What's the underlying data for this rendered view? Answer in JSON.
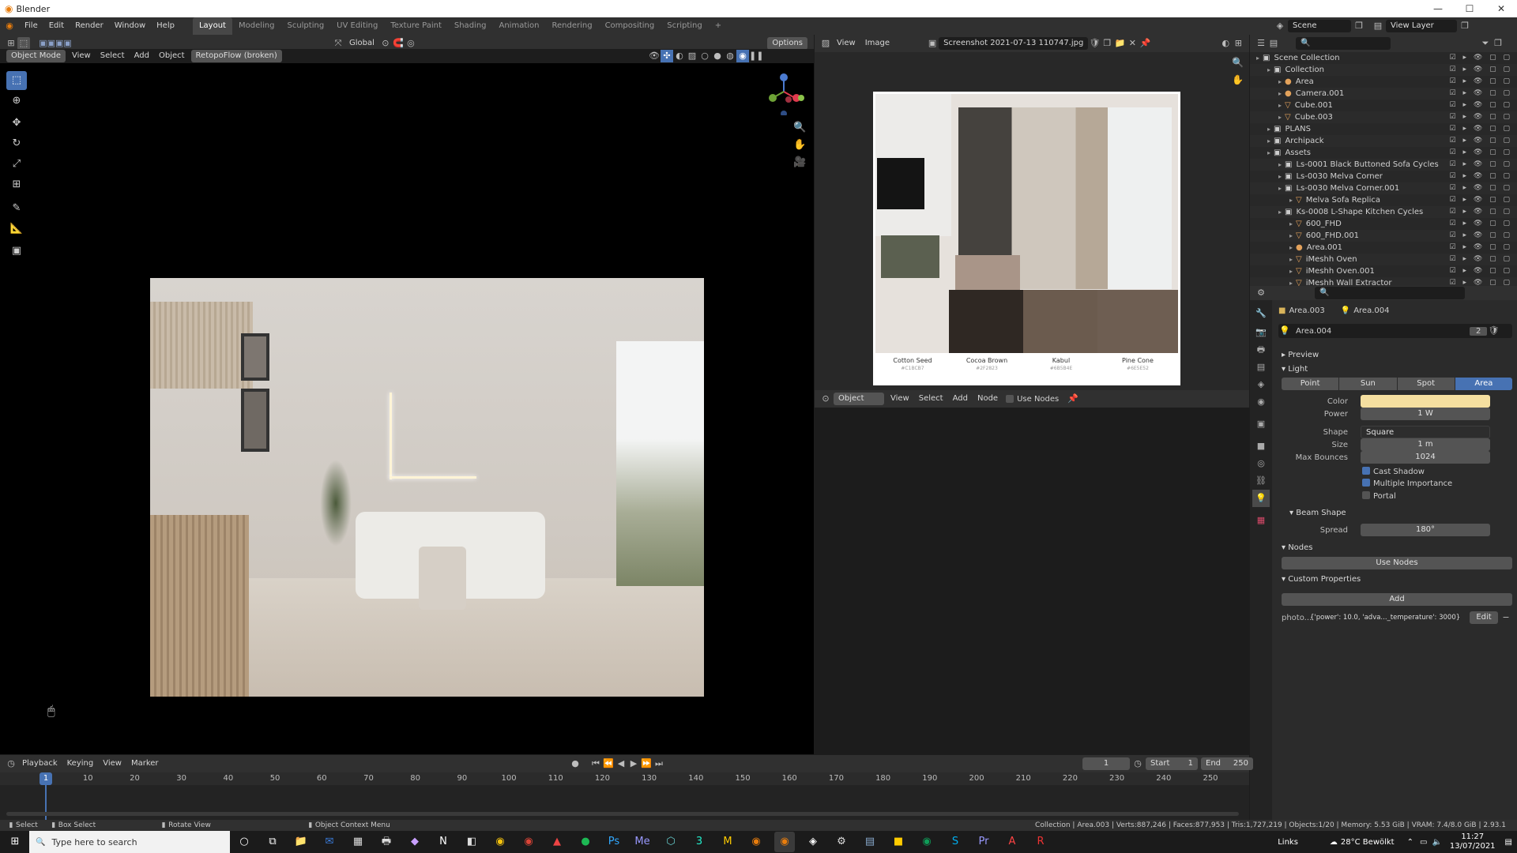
{
  "app": {
    "title": "Blender",
    "title_controls": [
      "—",
      "☐",
      "✕"
    ]
  },
  "menu": [
    "File",
    "Edit",
    "Render",
    "Window",
    "Help"
  ],
  "workspaces": [
    {
      "label": "Layout",
      "active": true
    },
    {
      "label": "Modeling"
    },
    {
      "label": "Sculpting"
    },
    {
      "label": "UV Editing"
    },
    {
      "label": "Texture Paint"
    },
    {
      "label": "Shading"
    },
    {
      "label": "Animation"
    },
    {
      "label": "Rendering"
    },
    {
      "label": "Compositing"
    },
    {
      "label": "Scripting"
    }
  ],
  "scene": {
    "name": "Scene",
    "view_layer": "View Layer"
  },
  "viewport": {
    "transform": "Global",
    "options": "Options",
    "mode": "Object Mode",
    "menus": [
      "View",
      "Select",
      "Add",
      "Object"
    ],
    "addon": "RetopoFlow (broken)"
  },
  "image_editor": {
    "menus": [
      "View",
      "Image"
    ],
    "filename": "Screenshot 2021-07-13 110747.jpg",
    "swatches": [
      {
        "name": "Cotton Seed",
        "code": "#C1BCB7"
      },
      {
        "name": "Cocoa Brown",
        "code": "#2F2823"
      },
      {
        "name": "Kabul",
        "code": "#6B5B4E"
      },
      {
        "name": "Pine Cone",
        "code": "#6E5E52"
      }
    ]
  },
  "node_editor": {
    "type": "Object",
    "menus": [
      "View",
      "Select",
      "Add",
      "Node"
    ],
    "use_nodes": "Use Nodes"
  },
  "outliner": {
    "items": [
      {
        "label": "Scene Collection",
        "indent": 0,
        "icon": "▣"
      },
      {
        "label": "Collection",
        "indent": 1,
        "icon": "▣"
      },
      {
        "label": "Area",
        "indent": 2,
        "icon": "●"
      },
      {
        "label": "Camera.001",
        "indent": 2,
        "icon": "●"
      },
      {
        "label": "Cube.001",
        "indent": 2,
        "icon": "▽"
      },
      {
        "label": "Cube.003",
        "indent": 2,
        "icon": "▽"
      },
      {
        "label": "PLANS",
        "indent": 1,
        "icon": "▣"
      },
      {
        "label": "Archipack",
        "indent": 1,
        "icon": "▣"
      },
      {
        "label": "Assets",
        "indent": 1,
        "icon": "▣"
      },
      {
        "label": "Ls-0001 Black Buttoned Sofa Cycles",
        "indent": 2,
        "icon": "▣"
      },
      {
        "label": "Ls-0030 Melva Corner",
        "indent": 2,
        "icon": "▣"
      },
      {
        "label": "Ls-0030 Melva Corner.001",
        "indent": 2,
        "icon": "▣"
      },
      {
        "label": "Melva Sofa Replica",
        "indent": 3,
        "icon": "▽"
      },
      {
        "label": "Ks-0008 L-Shape Kitchen Cycles",
        "indent": 2,
        "icon": "▣"
      },
      {
        "label": "600_FHD",
        "indent": 3,
        "icon": "▽"
      },
      {
        "label": "600_FHD.001",
        "indent": 3,
        "icon": "▽"
      },
      {
        "label": "Area.001",
        "indent": 3,
        "icon": "●"
      },
      {
        "label": "iMeshh Oven",
        "indent": 3,
        "icon": "▽"
      },
      {
        "label": "iMeshh Oven.001",
        "indent": 3,
        "icon": "▽"
      },
      {
        "label": "iMeshh Wall Extractor",
        "indent": 3,
        "icon": "▽"
      }
    ]
  },
  "properties": {
    "breadcrumb": [
      "Area.003",
      "Area.004"
    ],
    "datablock": "Area.004",
    "users": "2",
    "sections": {
      "preview": "Preview",
      "light": "Light",
      "beam": "Beam Shape",
      "nodes": "Nodes",
      "custom": "Custom Properties"
    },
    "light_types": [
      {
        "label": "Point"
      },
      {
        "label": "Sun"
      },
      {
        "label": "Spot"
      },
      {
        "label": "Area",
        "active": true
      }
    ],
    "color_label": "Color",
    "color": "#f5dfa0",
    "power_label": "Power",
    "power": "1 W",
    "shape_label": "Shape",
    "shape": "Square",
    "size_label": "Size",
    "size": "1 m",
    "bounces_label": "Max Bounces",
    "bounces": "1024",
    "cast_shadow": "Cast Shadow",
    "multiple_importance": "Multiple Importance",
    "portal": "Portal",
    "spread_label": "Spread",
    "spread": "180°",
    "use_nodes": "Use Nodes",
    "add": "Add",
    "custom_key": "photo...",
    "custom_value": "{'power': 10.0, 'adva..._temperature': 3000}",
    "edit": "Edit"
  },
  "timeline": {
    "menus": [
      "Playback",
      "Keying",
      "View",
      "Marker"
    ],
    "current": "1",
    "start_label": "Start",
    "start": "1",
    "end_label": "End",
    "end": "250",
    "ticks": [
      "1",
      "10",
      "20",
      "30",
      "40",
      "50",
      "60",
      "70",
      "80",
      "90",
      "100",
      "110",
      "120",
      "130",
      "140",
      "150",
      "160",
      "170",
      "180",
      "190",
      "200",
      "210",
      "220",
      "230",
      "240",
      "250"
    ]
  },
  "status": {
    "select": "Select",
    "box": "Box Select",
    "rotate": "Rotate View",
    "context": "Object Context Menu",
    "info": "Collection | Area.003 | Verts:887,246 | Faces:877,953 | Tris:1,727,219 | Objects:1/20 | Memory: 5.53 GiB | VRAM: 7.4/8.0 GiB | 2.93.1"
  },
  "taskbar": {
    "search": "Type here to search",
    "links": "Links",
    "weather": "28°C Bewölkt",
    "time": "11:27",
    "date": "13/07/2021"
  }
}
